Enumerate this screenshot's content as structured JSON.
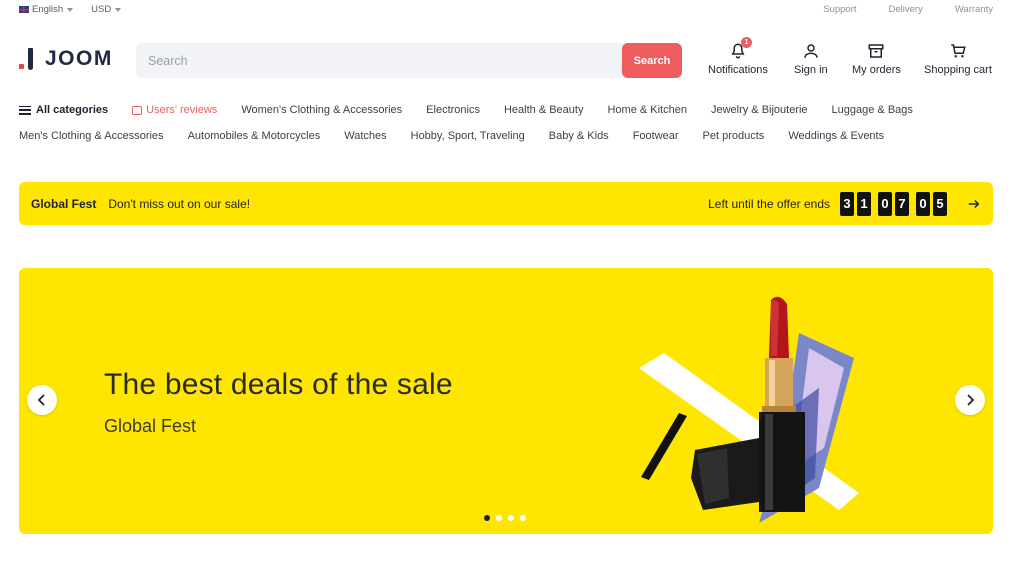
{
  "topbar": {
    "language": "English",
    "currency": "USD",
    "links": [
      "Support",
      "Delivery",
      "Warranty"
    ]
  },
  "header": {
    "logo_text": "JOOM",
    "search": {
      "placeholder": "Search",
      "value": "",
      "button_label": "Search"
    },
    "actions": {
      "notifications": {
        "label": "Notifications",
        "badge": "1",
        "icon": "bell-icon"
      },
      "signin": {
        "label": "Sign in",
        "icon": "user-icon"
      },
      "orders": {
        "label": "My orders",
        "icon": "box-icon"
      },
      "cart": {
        "label": "Shopping cart",
        "icon": "cart-icon"
      }
    }
  },
  "nav": {
    "all_categories": "All categories",
    "users_reviews": "Users' reviews",
    "row1": [
      "Women's Clothing & Accessories",
      "Electronics",
      "Health & Beauty",
      "Home & Kitchen",
      "Jewelry & Bijouterie",
      "Luggage & Bags"
    ],
    "row2": [
      "Men's Clothing & Accessories",
      "Automobiles & Motorcycles",
      "Watches",
      "Hobby, Sport, Traveling",
      "Baby & Kids",
      "Footwear",
      "Pet products",
      "Weddings & Events"
    ]
  },
  "promo": {
    "title": "Global Fest",
    "message": "Don't miss out on our sale!",
    "countdown_label": "Left until the offer ends",
    "countdown": [
      "3",
      "1",
      "0",
      "7",
      "0",
      "5"
    ]
  },
  "hero": {
    "title": "The best deals of the sale",
    "subtitle": "Global Fest",
    "slides_count": 4,
    "active_slide": 1
  },
  "colors": {
    "accent": "#f05d5e",
    "promo_bg": "#ffe600",
    "brand_dark": "#1f2a44"
  }
}
